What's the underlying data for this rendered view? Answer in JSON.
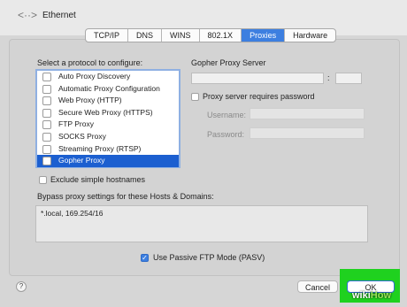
{
  "window": {
    "title": "Ethernet",
    "back_icon": "back-forward-arrows-icon"
  },
  "tabs": [
    {
      "label": "TCP/IP",
      "active": false
    },
    {
      "label": "DNS",
      "active": false
    },
    {
      "label": "WINS",
      "active": false
    },
    {
      "label": "802.1X",
      "active": false
    },
    {
      "label": "Proxies",
      "active": true
    },
    {
      "label": "Hardware",
      "active": false
    }
  ],
  "protocols": {
    "heading": "Select a protocol to configure:",
    "items": [
      {
        "label": "Auto Proxy Discovery",
        "checked": false,
        "selected": false
      },
      {
        "label": "Automatic Proxy Configuration",
        "checked": false,
        "selected": false
      },
      {
        "label": "Web Proxy (HTTP)",
        "checked": false,
        "selected": false
      },
      {
        "label": "Secure Web Proxy (HTTPS)",
        "checked": false,
        "selected": false
      },
      {
        "label": "FTP Proxy",
        "checked": false,
        "selected": false
      },
      {
        "label": "SOCKS Proxy",
        "checked": false,
        "selected": false
      },
      {
        "label": "Streaming Proxy (RTSP)",
        "checked": false,
        "selected": false
      },
      {
        "label": "Gopher Proxy",
        "checked": false,
        "selected": true
      }
    ]
  },
  "proxy_server": {
    "heading": "Gopher Proxy Server",
    "separator": ":",
    "host_value": "",
    "port_value": "",
    "requires_password_label": "Proxy server requires password",
    "username_label": "Username:",
    "password_label": "Password:"
  },
  "exclude_simple_hostnames": {
    "label": "Exclude simple hostnames",
    "checked": false
  },
  "bypass": {
    "heading": "Bypass proxy settings for these Hosts & Domains:",
    "value": "*.local, 169.254/16"
  },
  "passive_ftp": {
    "label": "Use Passive FTP Mode (PASV)",
    "checked": true
  },
  "buttons": {
    "help": "?",
    "cancel": "Cancel",
    "ok": "OK"
  },
  "watermark": {
    "part1": "wiki",
    "part2": "How"
  },
  "colors": {
    "accent": "#3d7fe0",
    "selection": "#1c5fd0",
    "highlight": "#1fd11f"
  }
}
